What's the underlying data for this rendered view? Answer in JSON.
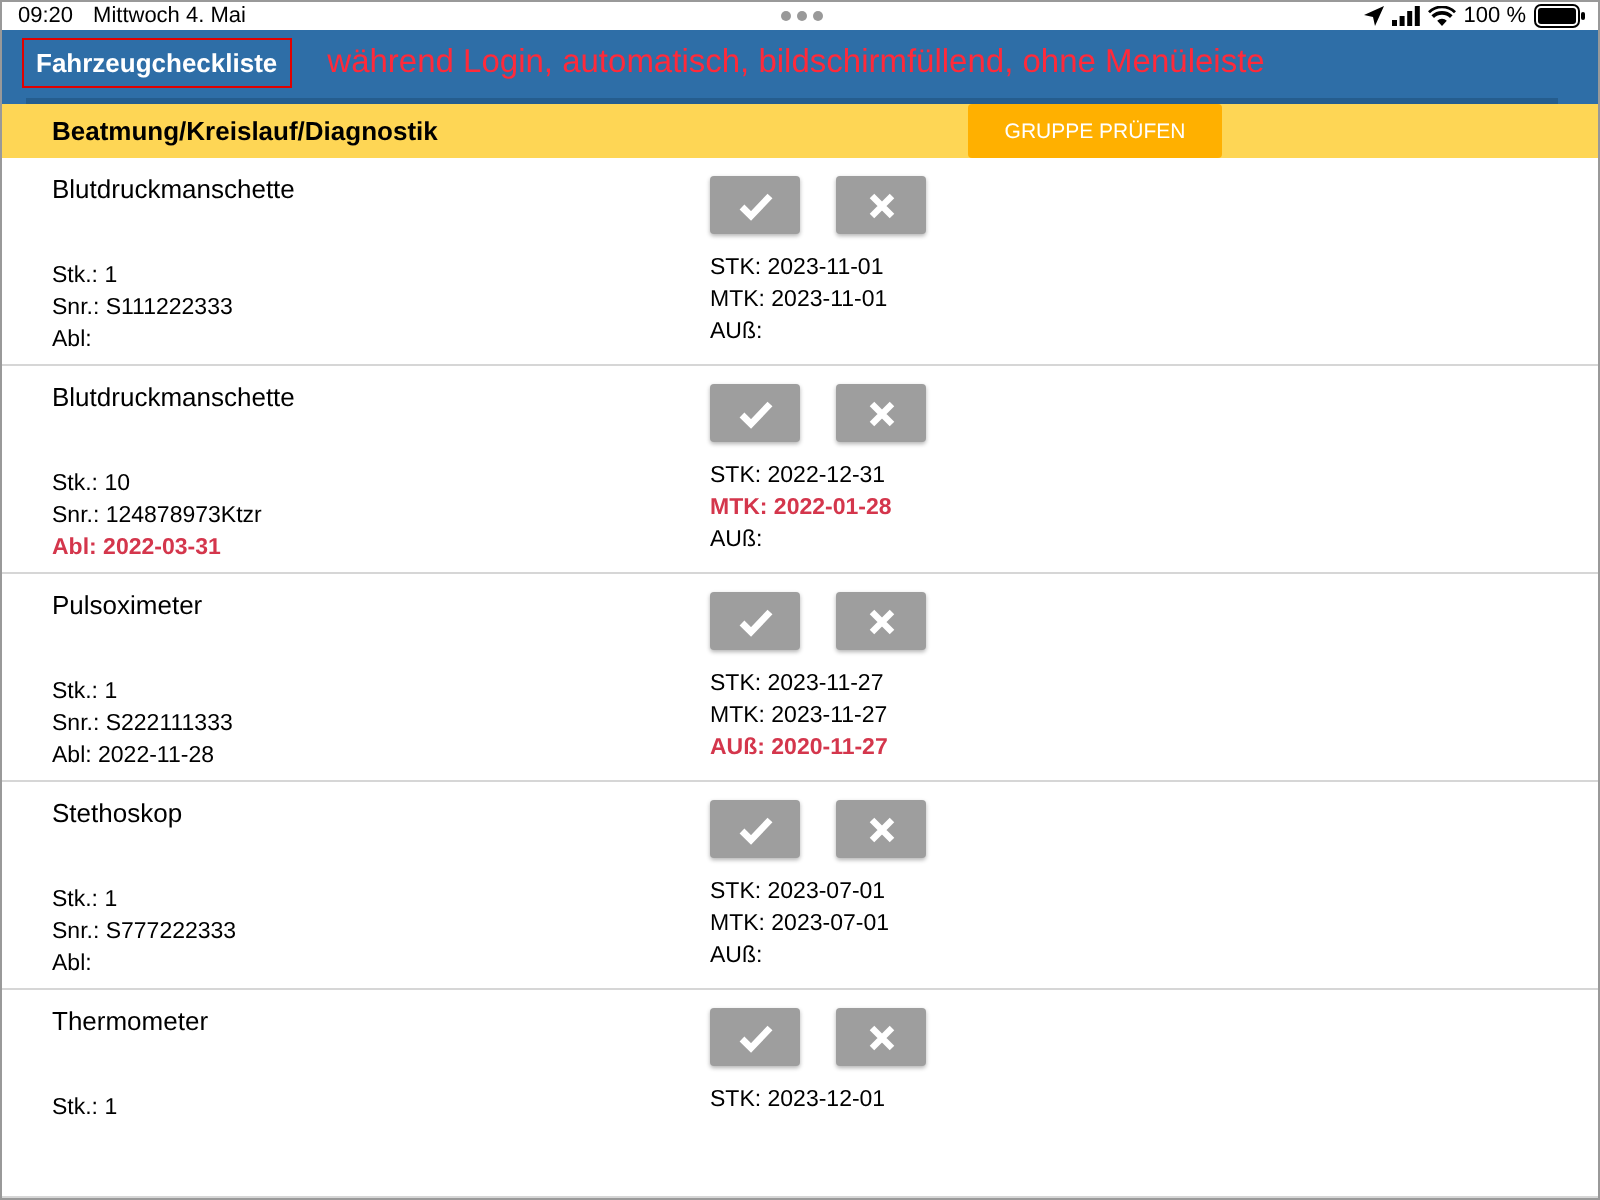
{
  "status_bar": {
    "time": "09:20",
    "date": "Mittwoch 4. Mai",
    "battery": "100 %"
  },
  "header": {
    "title": "Fahrzeugcheckliste",
    "annotation": "während Login, automatisch, bildschirmfüllend, ohne Menüleiste"
  },
  "group": {
    "name": "Beatmung/Kreislauf/Diagnostik",
    "button": "GRUPPE PRÜFEN"
  },
  "items": [
    {
      "name": "Blutdruckmanschette",
      "left": [
        {
          "text": "Stk.: 1",
          "warning": false
        },
        {
          "text": "Snr.: S111222333",
          "warning": false
        },
        {
          "text": "Abl:",
          "warning": false
        }
      ],
      "right": [
        {
          "text": "STK: 2023-11-01",
          "warning": false
        },
        {
          "text": "MTK: 2023-11-01",
          "warning": false
        },
        {
          "text": "AUß:",
          "warning": false
        }
      ]
    },
    {
      "name": "Blutdruckmanschette",
      "left": [
        {
          "text": "Stk.: 10",
          "warning": false
        },
        {
          "text": "Snr.: 124878973Ktzr",
          "warning": false
        },
        {
          "text": "Abl: 2022-03-31",
          "warning": true
        }
      ],
      "right": [
        {
          "text": "STK: 2022-12-31",
          "warning": false
        },
        {
          "text": "MTK: 2022-01-28",
          "warning": true
        },
        {
          "text": "AUß:",
          "warning": false
        }
      ]
    },
    {
      "name": "Pulsoximeter",
      "left": [
        {
          "text": "Stk.: 1",
          "warning": false
        },
        {
          "text": "Snr.: S222111333",
          "warning": false
        },
        {
          "text": "Abl: 2022-11-28",
          "warning": false
        }
      ],
      "right": [
        {
          "text": "STK: 2023-11-27",
          "warning": false
        },
        {
          "text": "MTK: 2023-11-27",
          "warning": false
        },
        {
          "text": "AUß: 2020-11-27",
          "warning": true
        }
      ]
    },
    {
      "name": "Stethoskop",
      "left": [
        {
          "text": "Stk.: 1",
          "warning": false
        },
        {
          "text": "Snr.: S777222333",
          "warning": false
        },
        {
          "text": "Abl:",
          "warning": false
        }
      ],
      "right": [
        {
          "text": "STK: 2023-07-01",
          "warning": false
        },
        {
          "text": "MTK: 2023-07-01",
          "warning": false
        },
        {
          "text": "AUß:",
          "warning": false
        }
      ]
    },
    {
      "name": "Thermometer",
      "left": [
        {
          "text": "Stk.: 1",
          "warning": false
        }
      ],
      "right": [
        {
          "text": "STK: 2023-12-01",
          "warning": false
        }
      ]
    }
  ]
}
